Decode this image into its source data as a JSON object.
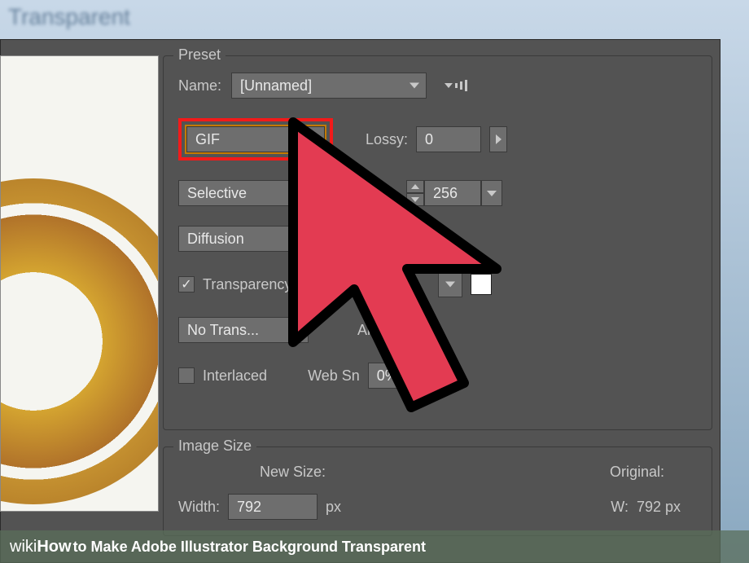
{
  "titlebar": "Transparent",
  "preset": {
    "legend": "Preset",
    "name_label": "Name:",
    "name_value": "[Unnamed]",
    "format": "GIF",
    "lossy_label": "Lossy:",
    "lossy_value": "0",
    "reduction": "Selective",
    "colors_value": "256",
    "dither": "Diffusion",
    "transparency_label": "Transparency",
    "transparency_checked": true,
    "matte_dither": "No Trans...",
    "amount_label": "Am",
    "interlaced_label": "Interlaced",
    "interlaced_checked": false,
    "websnap_label": "Web Sn",
    "websnap_value": "0%"
  },
  "image_size": {
    "legend": "Image Size",
    "new_size_label": "New Size:",
    "original_label": "Original:",
    "width_label": "Width:",
    "width_value": "792",
    "width_unit": "px",
    "orig_w_label": "W:",
    "orig_w_value": "792 px"
  },
  "caption": {
    "brand_prefix": "wiki",
    "brand_suffix": "How",
    "text": " to Make Adobe Illustrator Background Transparent"
  }
}
